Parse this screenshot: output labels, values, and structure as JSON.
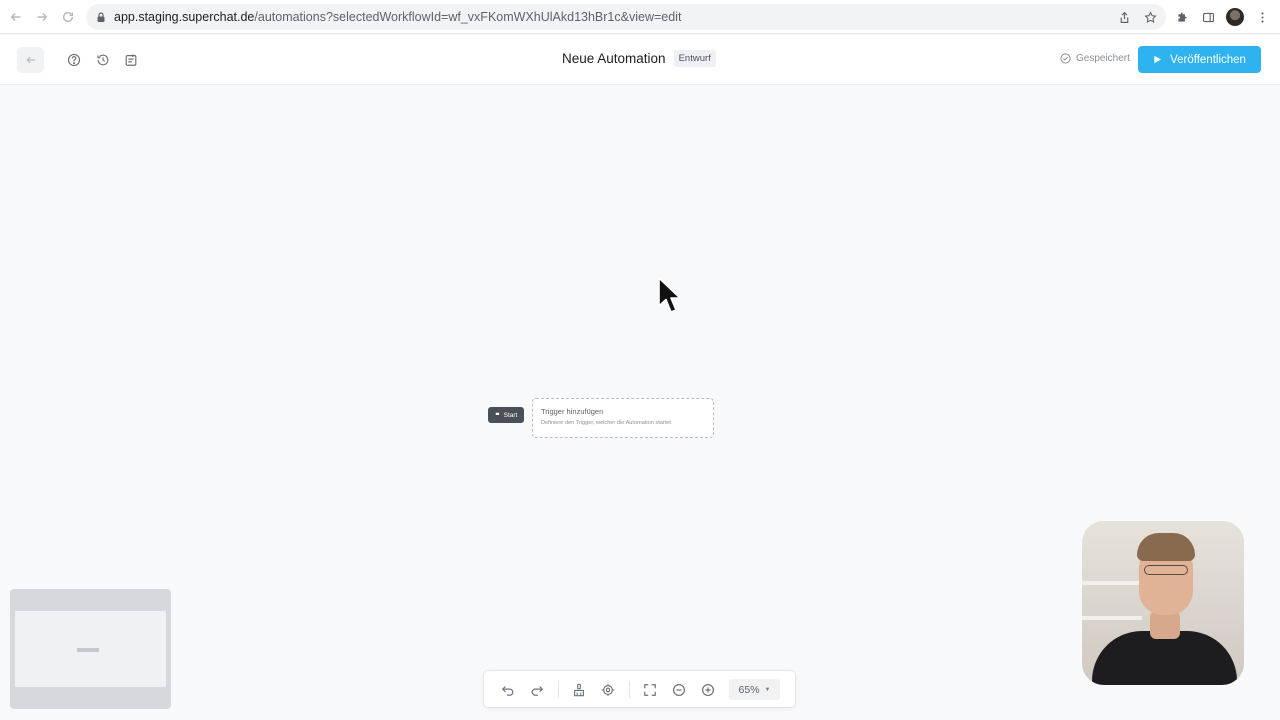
{
  "browser": {
    "url_host": "app.staging.superchat.de",
    "url_path": "/automations?selectedWorkflowId=wf_vxFKomWXhUlAkd13hBr1c&view=edit"
  },
  "header": {
    "title": "Neue Automation",
    "badge": "Entwurf",
    "saved_status": "Gespeichert",
    "publish_label": "Veröffentlichen"
  },
  "canvas": {
    "start_label": "Start",
    "trigger_title": "Trigger hinzufügen",
    "trigger_description": "Definiere den Trigger, welcher die Automation startet"
  },
  "toolbar": {
    "zoom": "65%"
  },
  "colors": {
    "accent": "#2fb3f0",
    "canvas_bg": "#f8f9fb"
  }
}
